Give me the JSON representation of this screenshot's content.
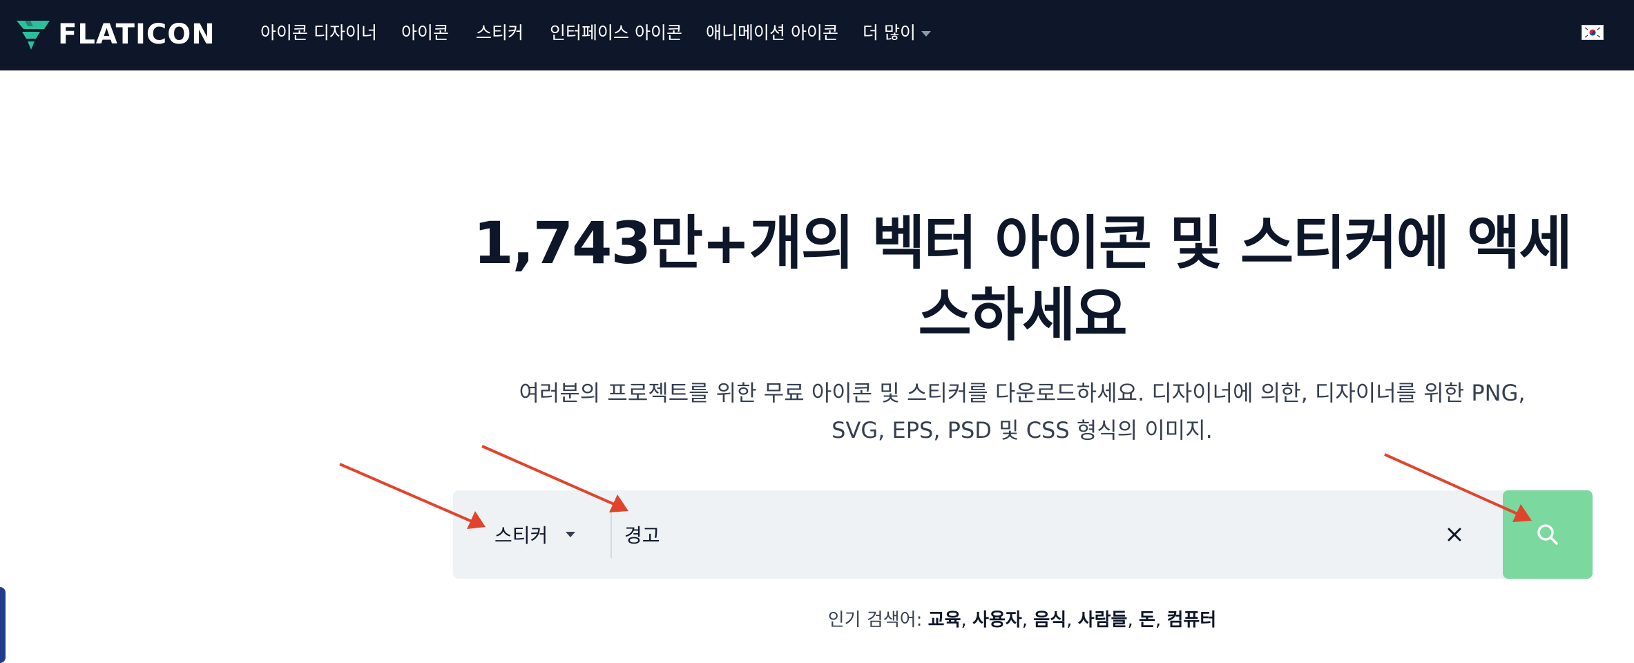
{
  "brand": {
    "name": "FLATICON",
    "accent": "#2bbf9e"
  },
  "nav": {
    "items": [
      {
        "label": "아이콘 디자이너"
      },
      {
        "label": "아이콘"
      },
      {
        "label": "스티커"
      },
      {
        "label": "인터페이스 아이콘"
      },
      {
        "label": "애니메이션 아이콘"
      },
      {
        "label": "더 많이"
      }
    ],
    "language_flag": "korea-flag-icon"
  },
  "hero": {
    "title": "1,743만+개의 벡터 아이콘 및 스티커에 액세스하세요",
    "subtitle": "여러분의 프로젝트를 위한 무료 아이콘 및 스티커를 다운로드하세요. 디자이너에 의한, 디자이너를 위한 PNG, SVG, EPS, PSD 및 CSS 형식의 이미지."
  },
  "search": {
    "type_selected": "스티커",
    "value": "경고",
    "clear_icon": "close-icon",
    "submit_icon": "search-icon"
  },
  "popular": {
    "prefix": "인기 검색어:",
    "terms": [
      "교육",
      "사용자",
      "음식",
      "사람들",
      "돈",
      "컴퓨터"
    ]
  },
  "colors": {
    "nav_bg": "#0e1629",
    "search_button": "#7bd89e",
    "search_bg": "#eff2f5",
    "annotation_arrow": "#e0452c"
  }
}
